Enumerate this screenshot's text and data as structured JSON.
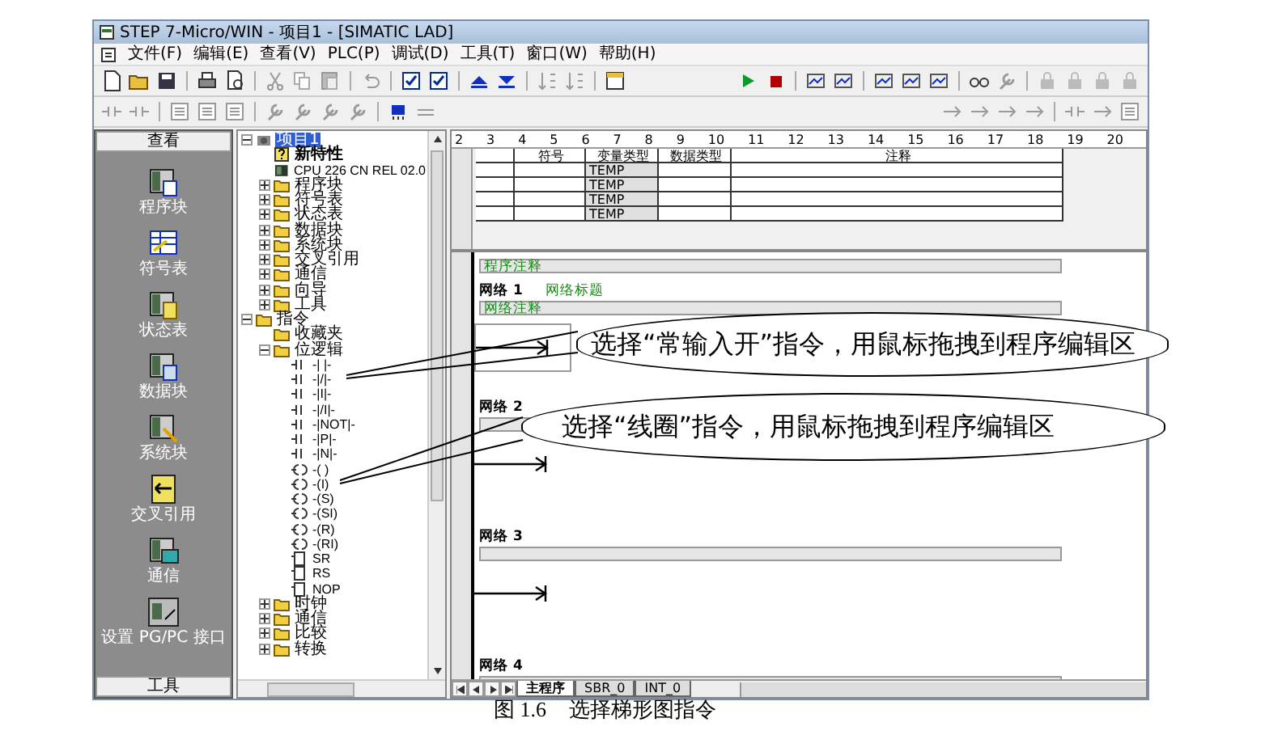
{
  "window": {
    "title": "STEP 7-Micro/WIN - 项目1 - [SIMATIC LAD]"
  },
  "menu": [
    "文件(F)",
    "编辑(E)",
    "查看(V)",
    "PLC(P)",
    "调试(D)",
    "工具(T)",
    "窗口(W)",
    "帮助(H)"
  ],
  "navbar": {
    "title": "查看",
    "footer": "工具",
    "items": [
      {
        "label": "程序块",
        "kind": "program",
        "selected": false
      },
      {
        "label": "符号表",
        "kind": "symbol",
        "selected": false
      },
      {
        "label": "状态表",
        "kind": "status",
        "selected": false
      },
      {
        "label": "数据块",
        "kind": "data",
        "selected": false
      },
      {
        "label": "系统块",
        "kind": "system",
        "selected": false
      },
      {
        "label": "交叉引用",
        "kind": "cross",
        "selected": false
      },
      {
        "label": "通信",
        "kind": "comm",
        "selected": false
      },
      {
        "label": "设置 PG/PC 接口",
        "kind": "pgpc",
        "selected": false
      }
    ]
  },
  "tree": [
    {
      "label": "项目1",
      "kind": "project",
      "expanded": true,
      "selected": true,
      "children": [
        {
          "label": "新特性",
          "kind": "help",
          "selected": false
        },
        {
          "label": "CPU 226 CN REL 02.0",
          "kind": "cpu",
          "selected": false
        },
        {
          "label": "程序块",
          "kind": "folder",
          "expanded": false,
          "selected": false
        },
        {
          "label": "符号表",
          "kind": "folder",
          "expanded": false,
          "selected": false
        },
        {
          "label": "状态表",
          "kind": "folder",
          "expanded": false,
          "selected": false
        },
        {
          "label": "数据块",
          "kind": "folder",
          "expanded": false,
          "selected": false
        },
        {
          "label": "系统块",
          "kind": "folder",
          "expanded": false,
          "selected": false
        },
        {
          "label": "交叉引用",
          "kind": "folder",
          "expanded": false,
          "selected": false
        },
        {
          "label": "通信",
          "kind": "folder",
          "expanded": false,
          "selected": false
        },
        {
          "label": "向导",
          "kind": "folder",
          "expanded": false,
          "selected": false
        },
        {
          "label": "工具",
          "kind": "folder",
          "expanded": false,
          "selected": false
        }
      ]
    },
    {
      "label": "指令",
      "kind": "folder",
      "expanded": true,
      "selected": false,
      "children": [
        {
          "label": "收藏夹",
          "kind": "folder",
          "selected": false
        },
        {
          "label": "位逻辑",
          "kind": "folder",
          "expanded": true,
          "selected": false,
          "children": [
            {
              "label": "-| |-",
              "kind": "contact",
              "selected": false
            },
            {
              "label": "-|/|-",
              "kind": "contact",
              "selected": false
            },
            {
              "label": "-|I|-",
              "kind": "contact",
              "selected": false
            },
            {
              "label": "-|/I|-",
              "kind": "contact",
              "selected": false
            },
            {
              "label": "-|NOT|-",
              "kind": "contact",
              "selected": false
            },
            {
              "label": "-|P|-",
              "kind": "contact",
              "selected": false
            },
            {
              "label": "-|N|-",
              "kind": "contact",
              "selected": false
            },
            {
              "label": "-( )",
              "kind": "coil",
              "selected": false
            },
            {
              "label": "-(I)",
              "kind": "coil",
              "selected": false
            },
            {
              "label": "-(S)",
              "kind": "coil",
              "selected": false
            },
            {
              "label": "-(SI)",
              "kind": "coil",
              "selected": false
            },
            {
              "label": "-(R)",
              "kind": "coil",
              "selected": false
            },
            {
              "label": "-(RI)",
              "kind": "coil",
              "selected": false
            },
            {
              "label": "SR",
              "kind": "box",
              "selected": false
            },
            {
              "label": "RS",
              "kind": "box",
              "selected": false
            },
            {
              "label": "NOP",
              "kind": "box",
              "selected": false
            }
          ]
        },
        {
          "label": "时钟",
          "kind": "folder",
          "expanded": false,
          "selected": false
        },
        {
          "label": "通信",
          "kind": "folder",
          "expanded": false,
          "selected": false
        },
        {
          "label": "比较",
          "kind": "folder",
          "expanded": false,
          "selected": false
        },
        {
          "label": "转换",
          "kind": "folder",
          "expanded": false,
          "selected": false
        }
      ]
    }
  ],
  "editor": {
    "ruler": [
      "2",
      "3",
      "4",
      "5",
      "6",
      "7",
      "8",
      "9",
      "10",
      "11",
      "12",
      "13",
      "14",
      "15",
      "16",
      "17",
      "18",
      "19",
      "20"
    ],
    "var_table": {
      "columns": [
        "符号",
        "变量类型",
        "数据类型",
        "注释"
      ],
      "rows": [
        {
          "var_type": "TEMP"
        },
        {
          "var_type": "TEMP"
        },
        {
          "var_type": "TEMP"
        },
        {
          "var_type": "TEMP"
        }
      ]
    },
    "program_comment": "程序注释",
    "networks": [
      {
        "label": "网络 1",
        "title": "网络标题",
        "comment": "网络注释",
        "focused": true
      },
      {
        "label": "网络 2",
        "focused": false
      },
      {
        "label": "网络 3",
        "focused": false
      },
      {
        "label": "网络 4",
        "focused": false
      }
    ],
    "tabs": [
      {
        "label": "主程序",
        "selected": true
      },
      {
        "label": "SBR_0",
        "selected": false
      },
      {
        "label": "INT_0",
        "selected": false
      }
    ]
  },
  "callouts": [
    {
      "text": "选择“常输入开”指令，用鼠标拖拽到程序编辑区"
    },
    {
      "text": "选择“线圈”指令，用鼠标拖拽到程序编辑区"
    }
  ],
  "caption": {
    "number": "图 1.6",
    "text": "选择梯形图指令"
  }
}
